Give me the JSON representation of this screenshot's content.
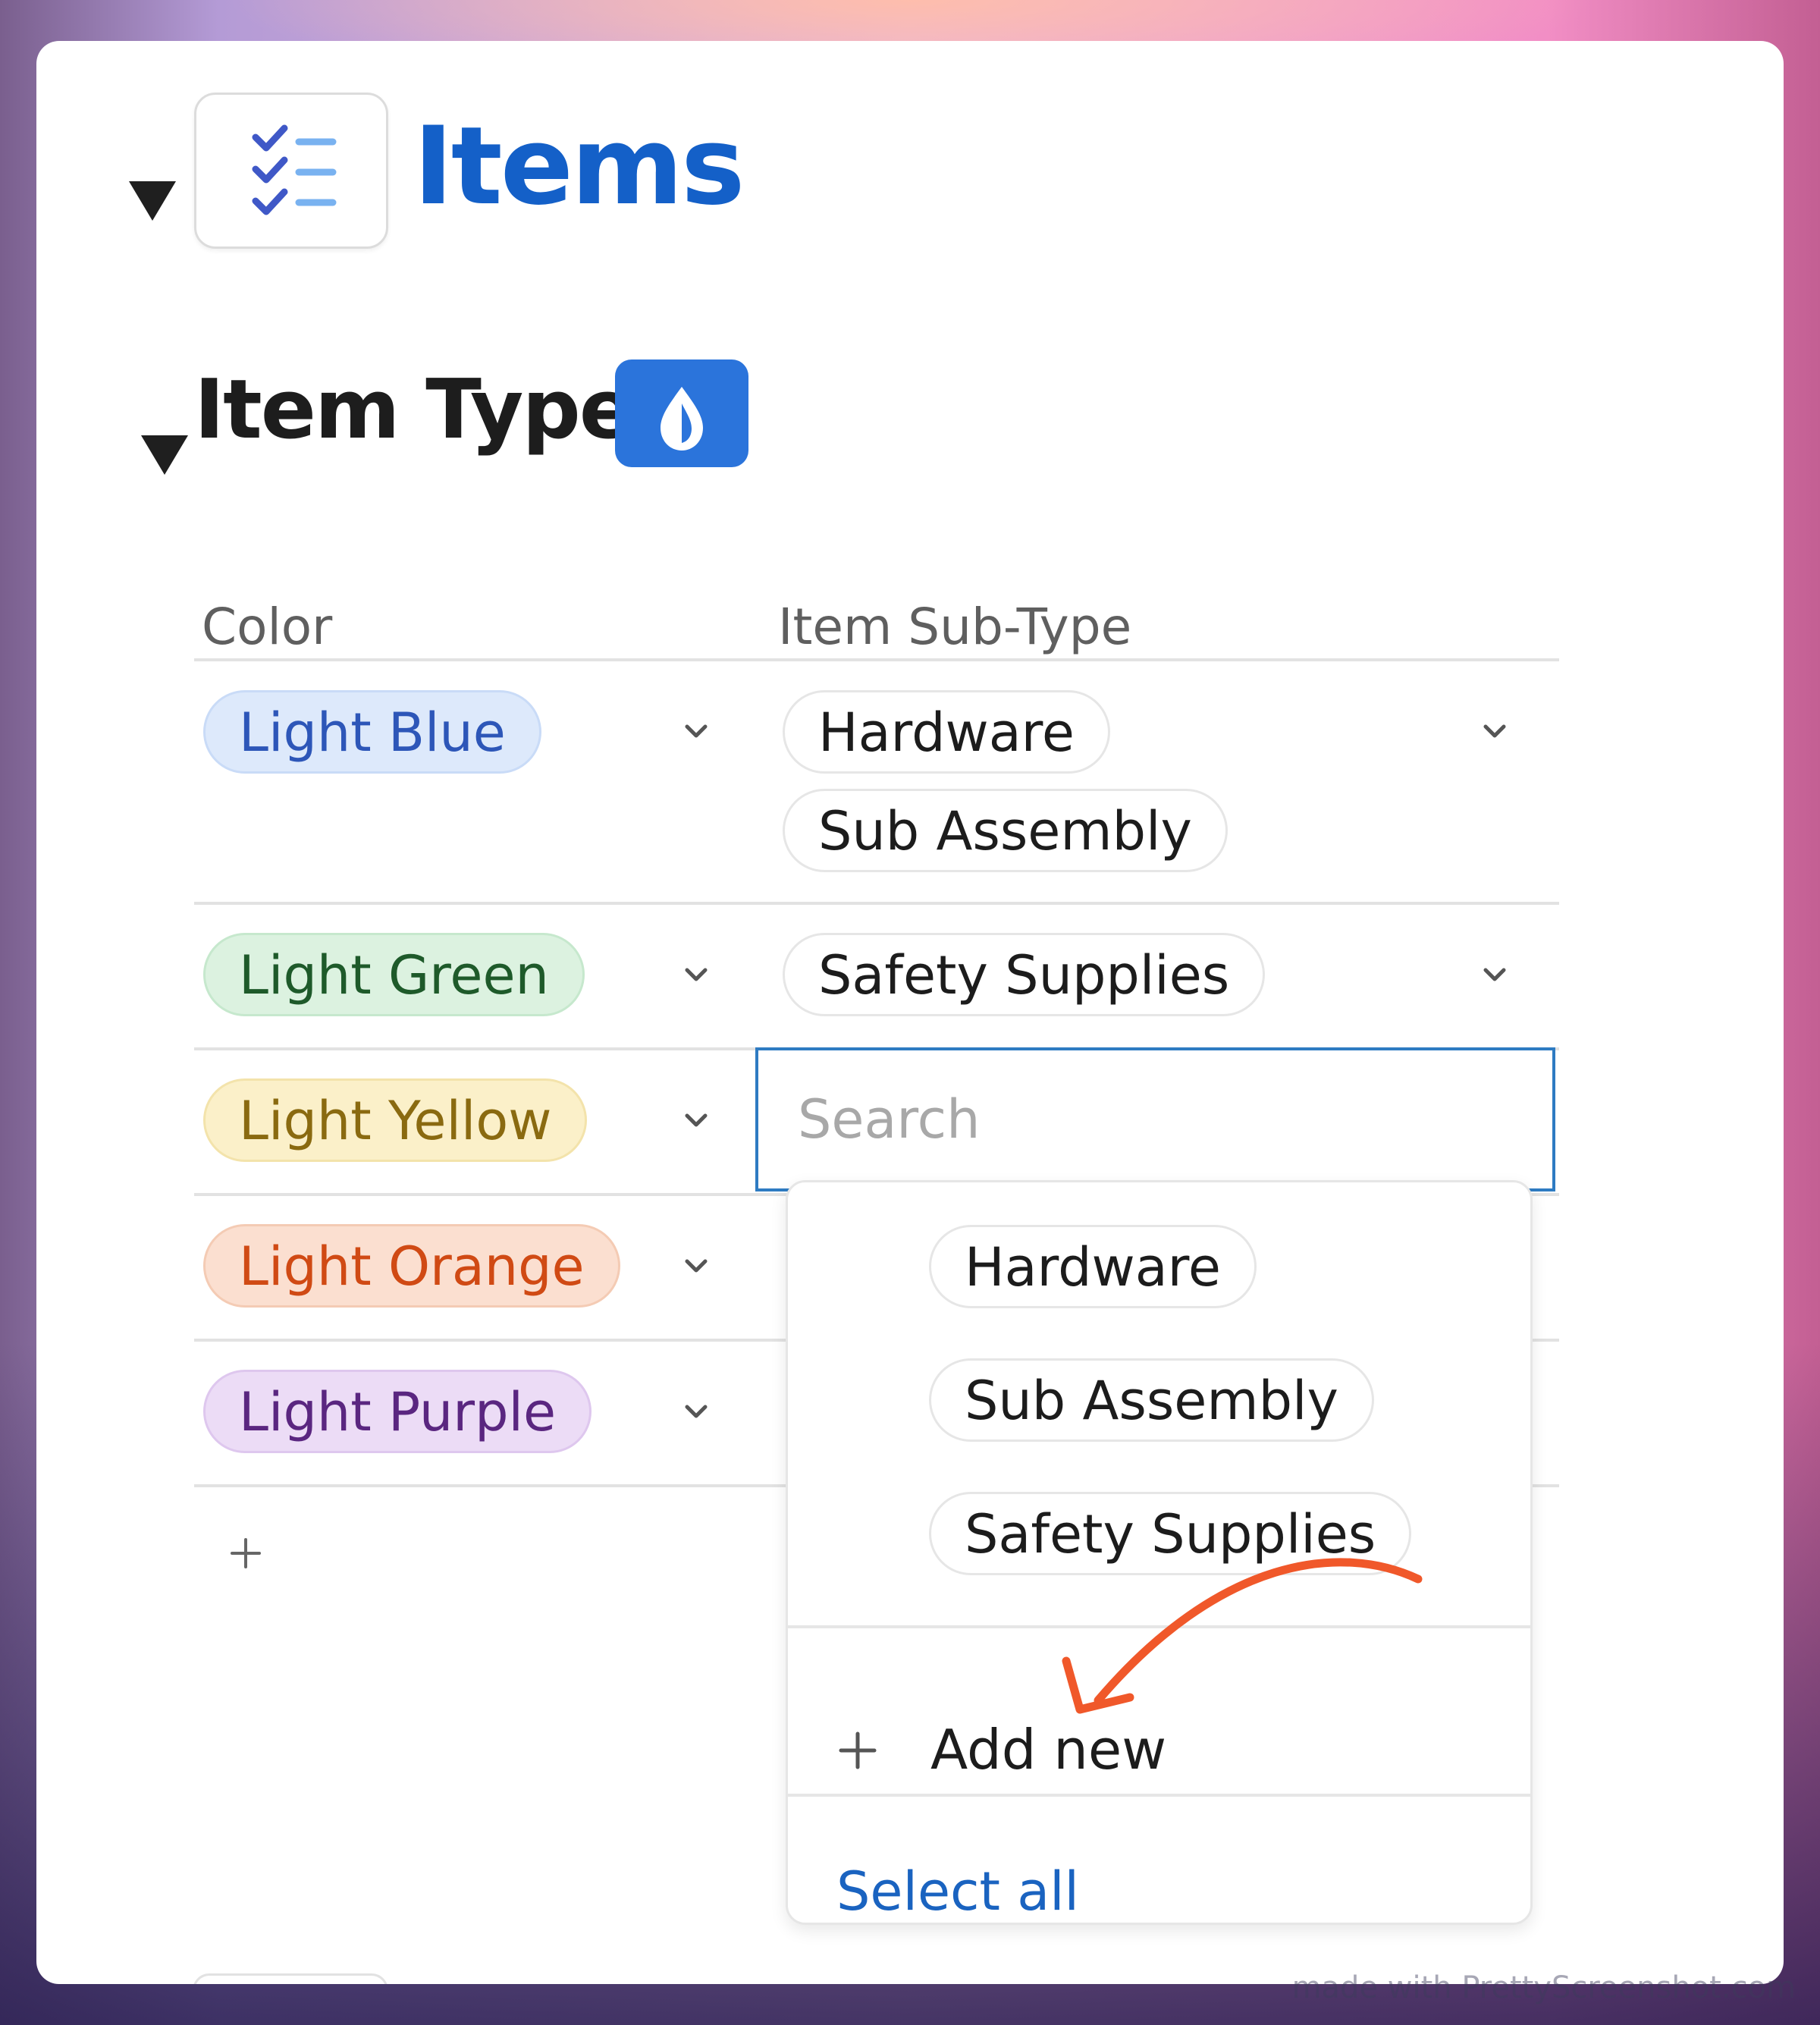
{
  "header": {
    "title": "Items",
    "icon": "checklist-icon"
  },
  "section": {
    "title": "Item Type",
    "badge_icon": "drop-icon"
  },
  "table": {
    "columns": [
      "Color",
      "Item Sub-Type"
    ],
    "rows": [
      {
        "color": "Light Blue",
        "subtypes": [
          "Hardware",
          "Sub Assembly"
        ]
      },
      {
        "color": "Light Green",
        "subtypes": [
          "Safety Supplies"
        ]
      },
      {
        "color": "Light Yellow",
        "subtypes": []
      },
      {
        "color": "Light Orange",
        "subtypes": []
      },
      {
        "color": "Light Purple",
        "subtypes": []
      }
    ],
    "add_row_label": "+"
  },
  "colors": {
    "accent": "#1460c8",
    "light_blue_bg": "#dde9fb",
    "light_blue_text": "#2d56b8",
    "light_green_bg": "#dcf2e0",
    "light_green_text": "#1e5a2a",
    "light_yellow_bg": "#fbf0c9",
    "light_yellow_text": "#8a6a10",
    "light_orange_bg": "#fbdfd0",
    "light_orange_text": "#d04a14",
    "light_purple_bg": "#ecdcf6",
    "light_purple_text": "#5a2680",
    "annotation_arrow": "#f0582a"
  },
  "search": {
    "placeholder": "Search"
  },
  "dropdown": {
    "options": [
      "Hardware",
      "Sub Assembly",
      "Safety Supplies"
    ],
    "add_new_label": "Add new",
    "select_all_label": "Select all"
  },
  "watermark": "made with PrettyScreenshot.com"
}
